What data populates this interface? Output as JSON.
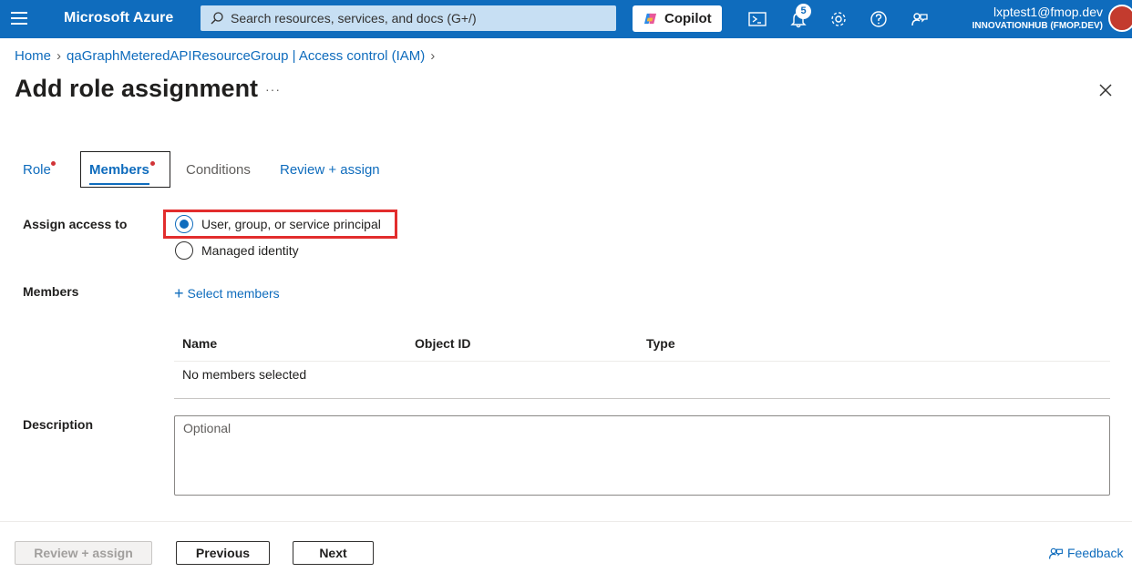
{
  "topbar": {
    "brand": "Microsoft Azure",
    "search_placeholder": "Search resources, services, and docs (G+/)",
    "copilot_label": "Copilot",
    "notification_count": "5",
    "account_email": "lxptest1@fmop.dev",
    "account_tenant": "INNOVATIONHUB (FMOP.DEV)",
    "icons": [
      "menu-icon",
      "search-icon",
      "copilot-icon",
      "cloud-shell-icon",
      "bell-icon",
      "gear-icon",
      "help-icon",
      "feedback-icon"
    ]
  },
  "breadcrumb": {
    "home": "Home",
    "resource": "qaGraphMeteredAPIResourceGroup | Access control (IAM)"
  },
  "page": {
    "title": "Add role assignment",
    "more": "···"
  },
  "tabs": [
    {
      "label": "Role",
      "required": true
    },
    {
      "label": "Members",
      "required": true,
      "active": true
    },
    {
      "label": "Conditions"
    },
    {
      "label": "Review + assign"
    }
  ],
  "form": {
    "assign_access_label": "Assign access to",
    "options": [
      {
        "label": "User, group, or service principal",
        "checked": true
      },
      {
        "label": "Managed identity",
        "checked": false
      }
    ],
    "members_label": "Members",
    "select_members": "Select members",
    "table": {
      "columns": [
        "Name",
        "Object ID",
        "Type"
      ],
      "empty": "No members selected"
    },
    "description_label": "Description",
    "description_placeholder": "Optional"
  },
  "footer": {
    "review_assign": "Review + assign",
    "previous": "Previous",
    "next": "Next",
    "feedback": "Feedback"
  },
  "colors": {
    "azure_blue": "#0f6cbd",
    "highlight_red": "#e22d2d",
    "required_dot": "#d13438"
  }
}
